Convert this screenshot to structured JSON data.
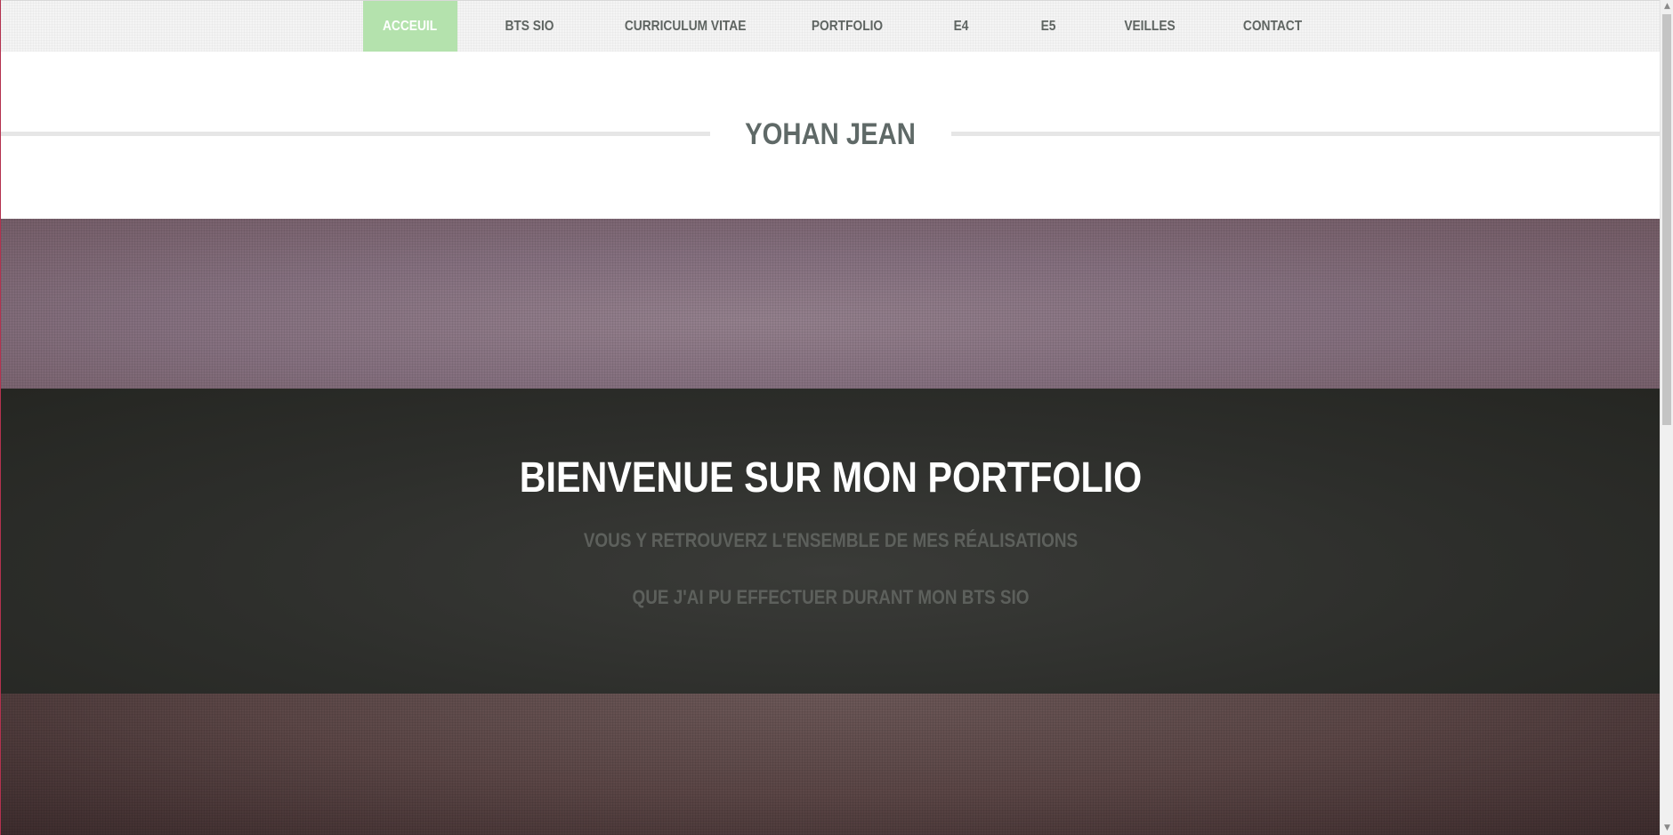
{
  "nav": {
    "items": [
      {
        "label": "ACCEUIL",
        "active": true
      },
      {
        "label": "BTS SIO",
        "active": false
      },
      {
        "label": "CURRICULUM VITAE",
        "active": false
      },
      {
        "label": "PORTFOLIO",
        "active": false
      },
      {
        "label": "E4",
        "active": false
      },
      {
        "label": "E5",
        "active": false
      },
      {
        "label": "VEILLES",
        "active": false
      },
      {
        "label": "CONTACT",
        "active": false
      }
    ]
  },
  "header": {
    "title": "YOHAN JEAN"
  },
  "hero": {
    "heading": "BIENVENUE SUR MON PORTFOLIO",
    "line1": "VOUS Y RETROUVERZ L'ENSEMBLE DE MES RÉALISATIONS",
    "line2": "QUE J'AI PU EFFECTUER DURANT MON BTS SIO"
  },
  "colors": {
    "active_nav_bg": "#b4e2ad",
    "nav_text": "#5e6461",
    "title_text": "#5f6967",
    "hero_band": "#2d2e2b"
  },
  "scrollbar": {
    "up_icon": "chevron-up-icon",
    "down_icon": "chevron-down-icon"
  }
}
